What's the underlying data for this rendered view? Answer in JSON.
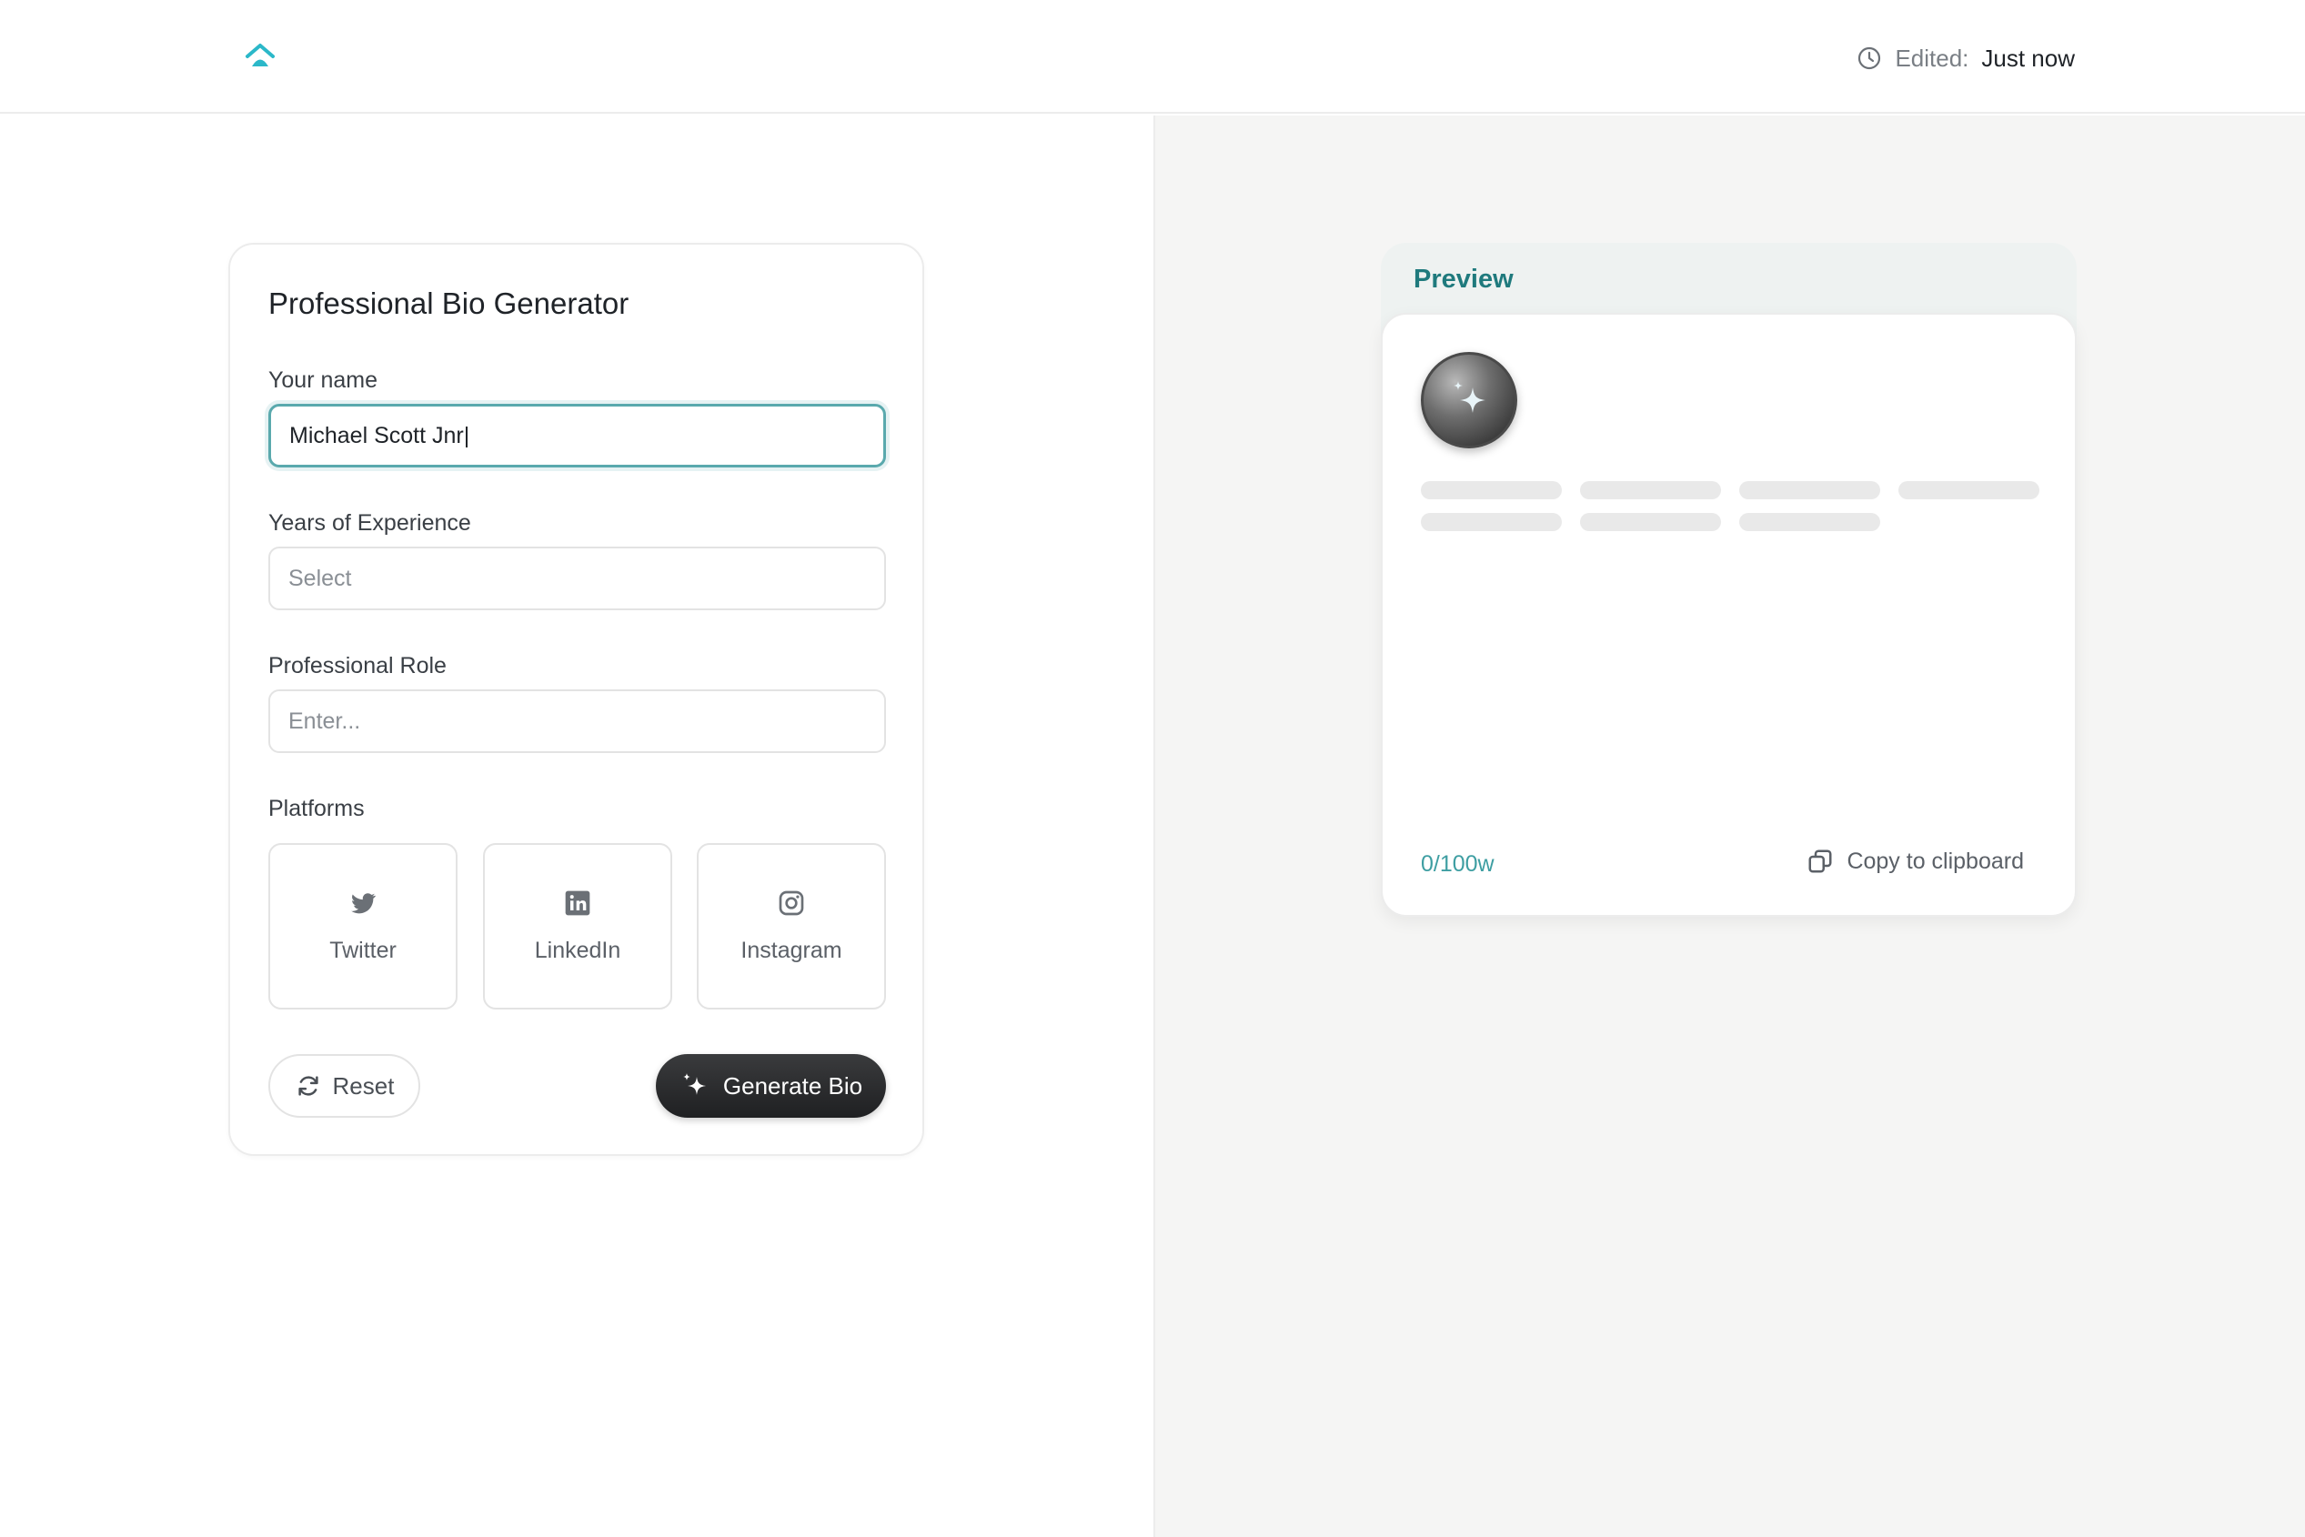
{
  "header": {
    "edited_label": "Edited:",
    "edited_value": "Just now",
    "accent_color": "#2bb8c9"
  },
  "form": {
    "title": "Professional Bio Generator",
    "name_label": "Your name",
    "name_value": "Michael Scott Jnr|",
    "experience_label": "Years of Experience",
    "experience_placeholder": "Select",
    "role_label": "Professional Role",
    "role_placeholder": "Enter...",
    "platforms_label": "Platforms",
    "platforms": [
      {
        "label": "Twitter",
        "icon": "twitter-icon"
      },
      {
        "label": "LinkedIn",
        "icon": "linkedin-icon"
      },
      {
        "label": "Instagram",
        "icon": "instagram-icon"
      }
    ],
    "reset_label": "Reset",
    "generate_label": "Generate Bio"
  },
  "preview": {
    "title": "Preview",
    "word_count": "0/100w",
    "copy_label": "Copy to clipboard",
    "accent_color": "#1f7a7d"
  }
}
